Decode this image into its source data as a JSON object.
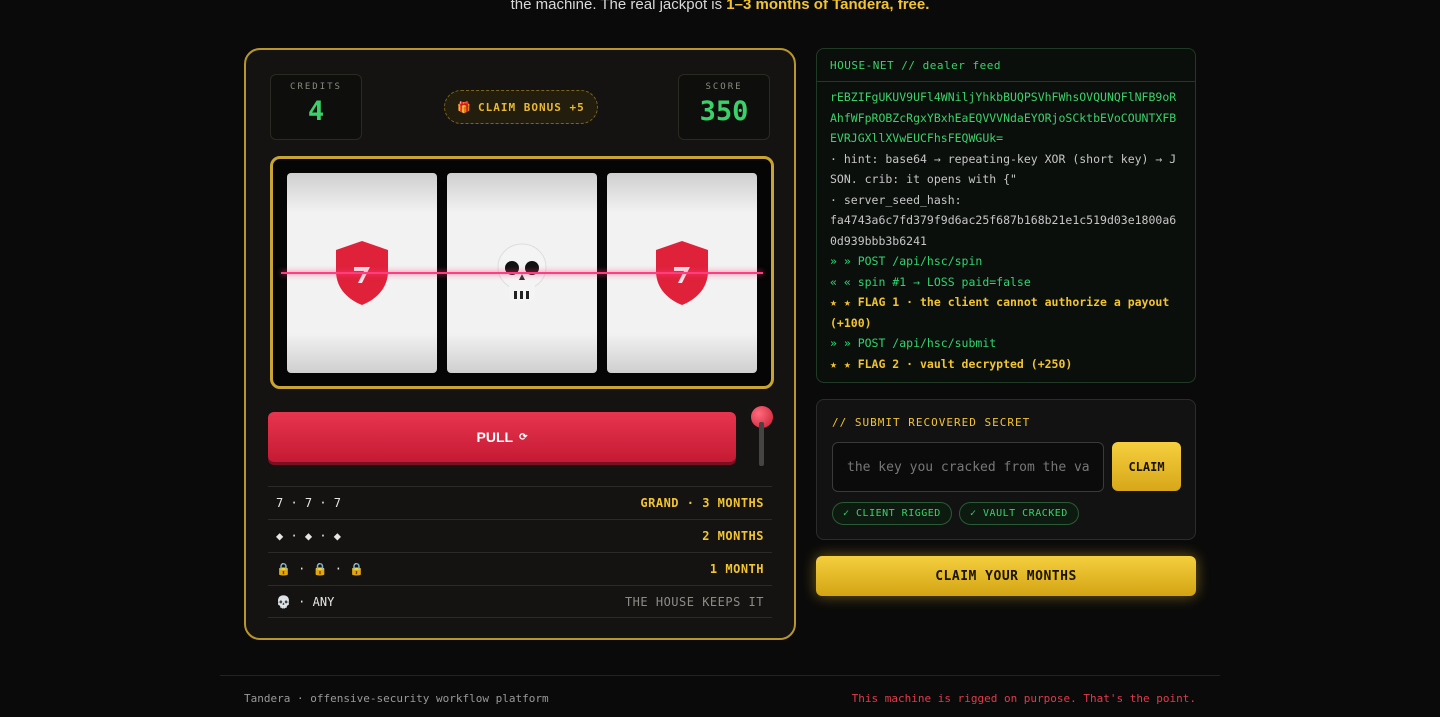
{
  "intro": {
    "text": "the machine. The real jackpot is ",
    "highlight": "1–3 months of Tandera, free."
  },
  "machine": {
    "credits_label": "CREDITS",
    "credits_value": "4",
    "score_label": "SCORE",
    "score_value": "350",
    "bonus_label": "CLAIM BONUS +5",
    "bonus_icon": "gift-icon",
    "reels": [
      "shield-seven-icon",
      "skull-icon",
      "shield-seven-icon"
    ],
    "pull_label": "PULL",
    "pull_icon": "⟳",
    "paytable": [
      {
        "symbols": "7 · 7 · 7",
        "prize": "GRAND · 3 MONTHS"
      },
      {
        "symbols": "◆ · ◆ · ◆",
        "prize": "2 MONTHS"
      },
      {
        "symbols": "🔒 · 🔒 · 🔒",
        "prize": "1 MONTH"
      },
      {
        "symbols": "💀 · ANY",
        "prize": "THE HOUSE KEEPS IT"
      }
    ]
  },
  "feed": {
    "title": "HOUSE-NET // dealer feed",
    "cipher": "rEBZIFgUKUV9UFl4WNiljYhkbBUQPSVhFWhsOVQUNQFlNFB9oRAhfWFpROBZcRgxYBxhEaEQVVVNdaEYORjoSCktbEVoCOUNTXFBEVRJGXllXVwEUCFhsFEQWGUk=",
    "hint": "· hint: base64 → repeating-key XOR (short key) → JSON. crib: it opens with {\"",
    "seed_label": "· server_seed_hash:",
    "seed_hash": "fa4743a6c7fd379f9d6ac25f687b168b21e1c519d03e1800a60d939bbb3b6241",
    "lines": [
      {
        "kind": "req",
        "text": "» » POST /api/hsc/spin"
      },
      {
        "kind": "res",
        "text": "« « spin #1 → LOSS  paid=false"
      },
      {
        "kind": "flag",
        "text": "★ ★ FLAG 1 · the client cannot authorize a payout (+100)"
      },
      {
        "kind": "req",
        "text": "» » POST /api/hsc/submit"
      },
      {
        "kind": "flag",
        "text": "★ ★ FLAG 2 · vault decrypted (+250)"
      }
    ]
  },
  "submit": {
    "title": "// SUBMIT RECOVERED SECRET",
    "placeholder": "the key you cracked from the vault",
    "claim_label": "CLAIM",
    "chips": [
      "✓ CLIENT RIGGED",
      "✓ VAULT CRACKED"
    ]
  },
  "claim_months_label": "CLAIM YOUR MONTHS",
  "footer": {
    "left": "Tandera · offensive-security workflow platform",
    "right": "This machine is rigged on purpose. That's the point."
  },
  "colors": {
    "gold": "#f2c431",
    "green": "#3bd16a",
    "red": "#e8354f",
    "payline": "#ff3d7f"
  }
}
